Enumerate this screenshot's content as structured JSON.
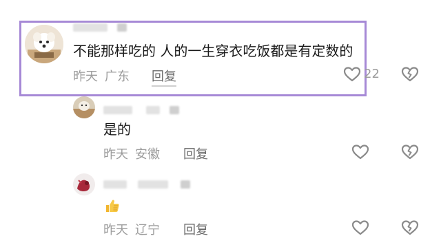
{
  "colors": {
    "highlight_border": "#a689d6",
    "meta_text": "#9c9c9c",
    "body_text": "#1a1a1a",
    "icon_stroke": "#8a8a8a"
  },
  "comments": [
    {
      "text": "不能那样吃的 人的一生穿衣吃饭都是有定数的",
      "date": "昨天",
      "location": "广东",
      "reply_label": "回复",
      "like_count": "22",
      "highlighted": true
    },
    {
      "text": "是的",
      "date": "昨天",
      "location": "安徽",
      "reply_label": "回复"
    },
    {
      "text": "",
      "emoji": "thumbs-up",
      "date": "昨天",
      "location": "辽宁",
      "reply_label": "回复"
    }
  ],
  "icons": {
    "like": "heart-icon",
    "dislike": "broken-heart-icon"
  }
}
